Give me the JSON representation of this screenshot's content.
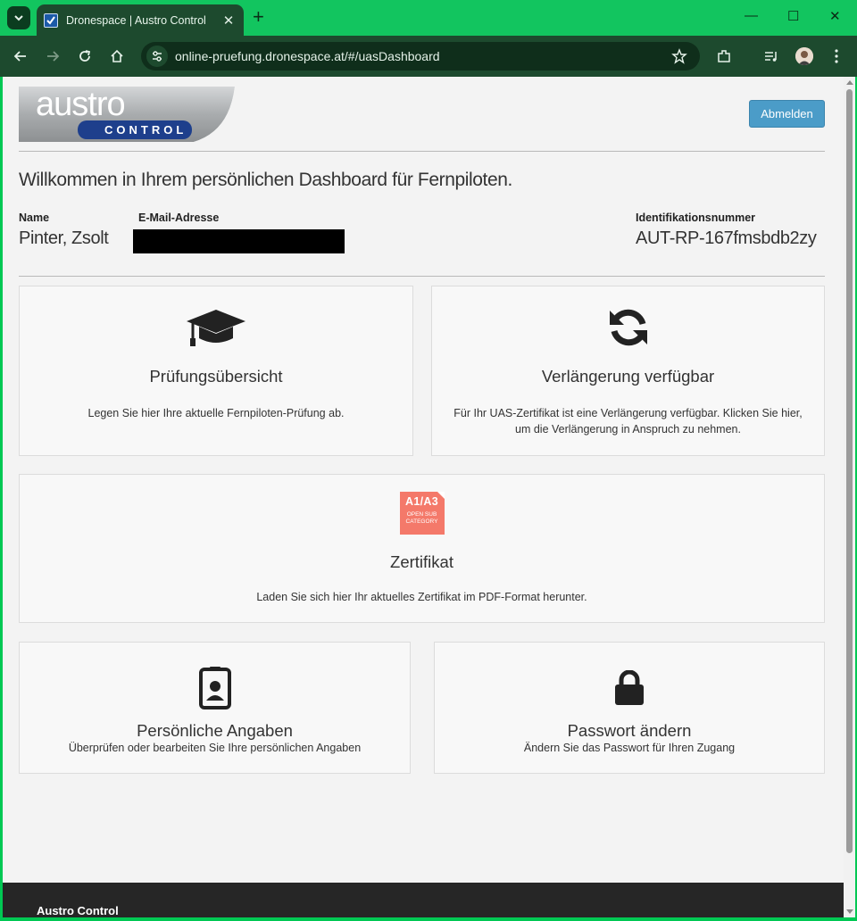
{
  "browser": {
    "tab_title": "Dronespace | Austro Control",
    "url": "online-pruefung.dronespace.at/#/uasDashboard",
    "new_tab": "+",
    "tab_close": "✕",
    "window_controls": {
      "minimize": "—",
      "maximize": "☐",
      "close": "✕"
    },
    "icons": [
      "tab-search-icon",
      "favicon-icon",
      "back-icon",
      "forward-icon",
      "reload-icon",
      "home-icon",
      "site-settings-icon",
      "bookmark-star-icon",
      "extensions-icon",
      "media-icon",
      "profile-avatar",
      "menu-icon"
    ]
  },
  "header": {
    "logo_text_top": "austro",
    "logo_text_bottom": "CONTROL",
    "logout_label": "Abmelden"
  },
  "welcome": "Willkommen in Ihrem persönlichen Dashboard für Fernpiloten.",
  "user": {
    "name_label": "Name",
    "name_value": "Pinter, Zsolt",
    "email_label": "E-Mail-Adresse",
    "email_value_redacted": true,
    "id_label": "Identifikationsnummer",
    "id_value": "AUT-RP-167fmsbdb2zy"
  },
  "cards": {
    "exam": {
      "icon": "graduation-cap-icon",
      "title": "Prüfungsübersicht",
      "desc": "Legen Sie hier Ihre aktuelle Fernpiloten-Prüfung ab."
    },
    "renewal": {
      "icon": "refresh-icon",
      "title": "Verlängerung verfügbar",
      "desc": "Für Ihr UAS-Zertifikat ist eine Verlängerung verfügbar. Klicken Sie hier, um die Verlängerung in Anspruch zu nehmen."
    },
    "certificate": {
      "icon": "certificate-badge-icon",
      "badge_line1": "A1/A3",
      "badge_line2": "OPEN SUB",
      "badge_line3": "CATEGORY",
      "badge_color": "#f4796a",
      "title": "Zertifikat",
      "desc": "Laden Sie sich hier Ihr aktuelles Zertifikat im PDF-Format herunter."
    },
    "personal": {
      "icon": "id-badge-icon",
      "title": "Persönliche Angaben",
      "desc": "Überprüfen oder bearbeiten Sie Ihre persönlichen Angaben"
    },
    "password": {
      "icon": "lock-icon",
      "title": "Passwort ändern",
      "desc": "Ändern Sie das Passwort für Ihren Zugang"
    }
  },
  "footer": {
    "text": "Austro Control"
  },
  "colors": {
    "browser_frame": "#12c55f",
    "toolbar": "#1d4a2e",
    "logout_button": "#4b9cc8",
    "page_bg": "#f3f3f3",
    "footer_bg": "#262626"
  }
}
